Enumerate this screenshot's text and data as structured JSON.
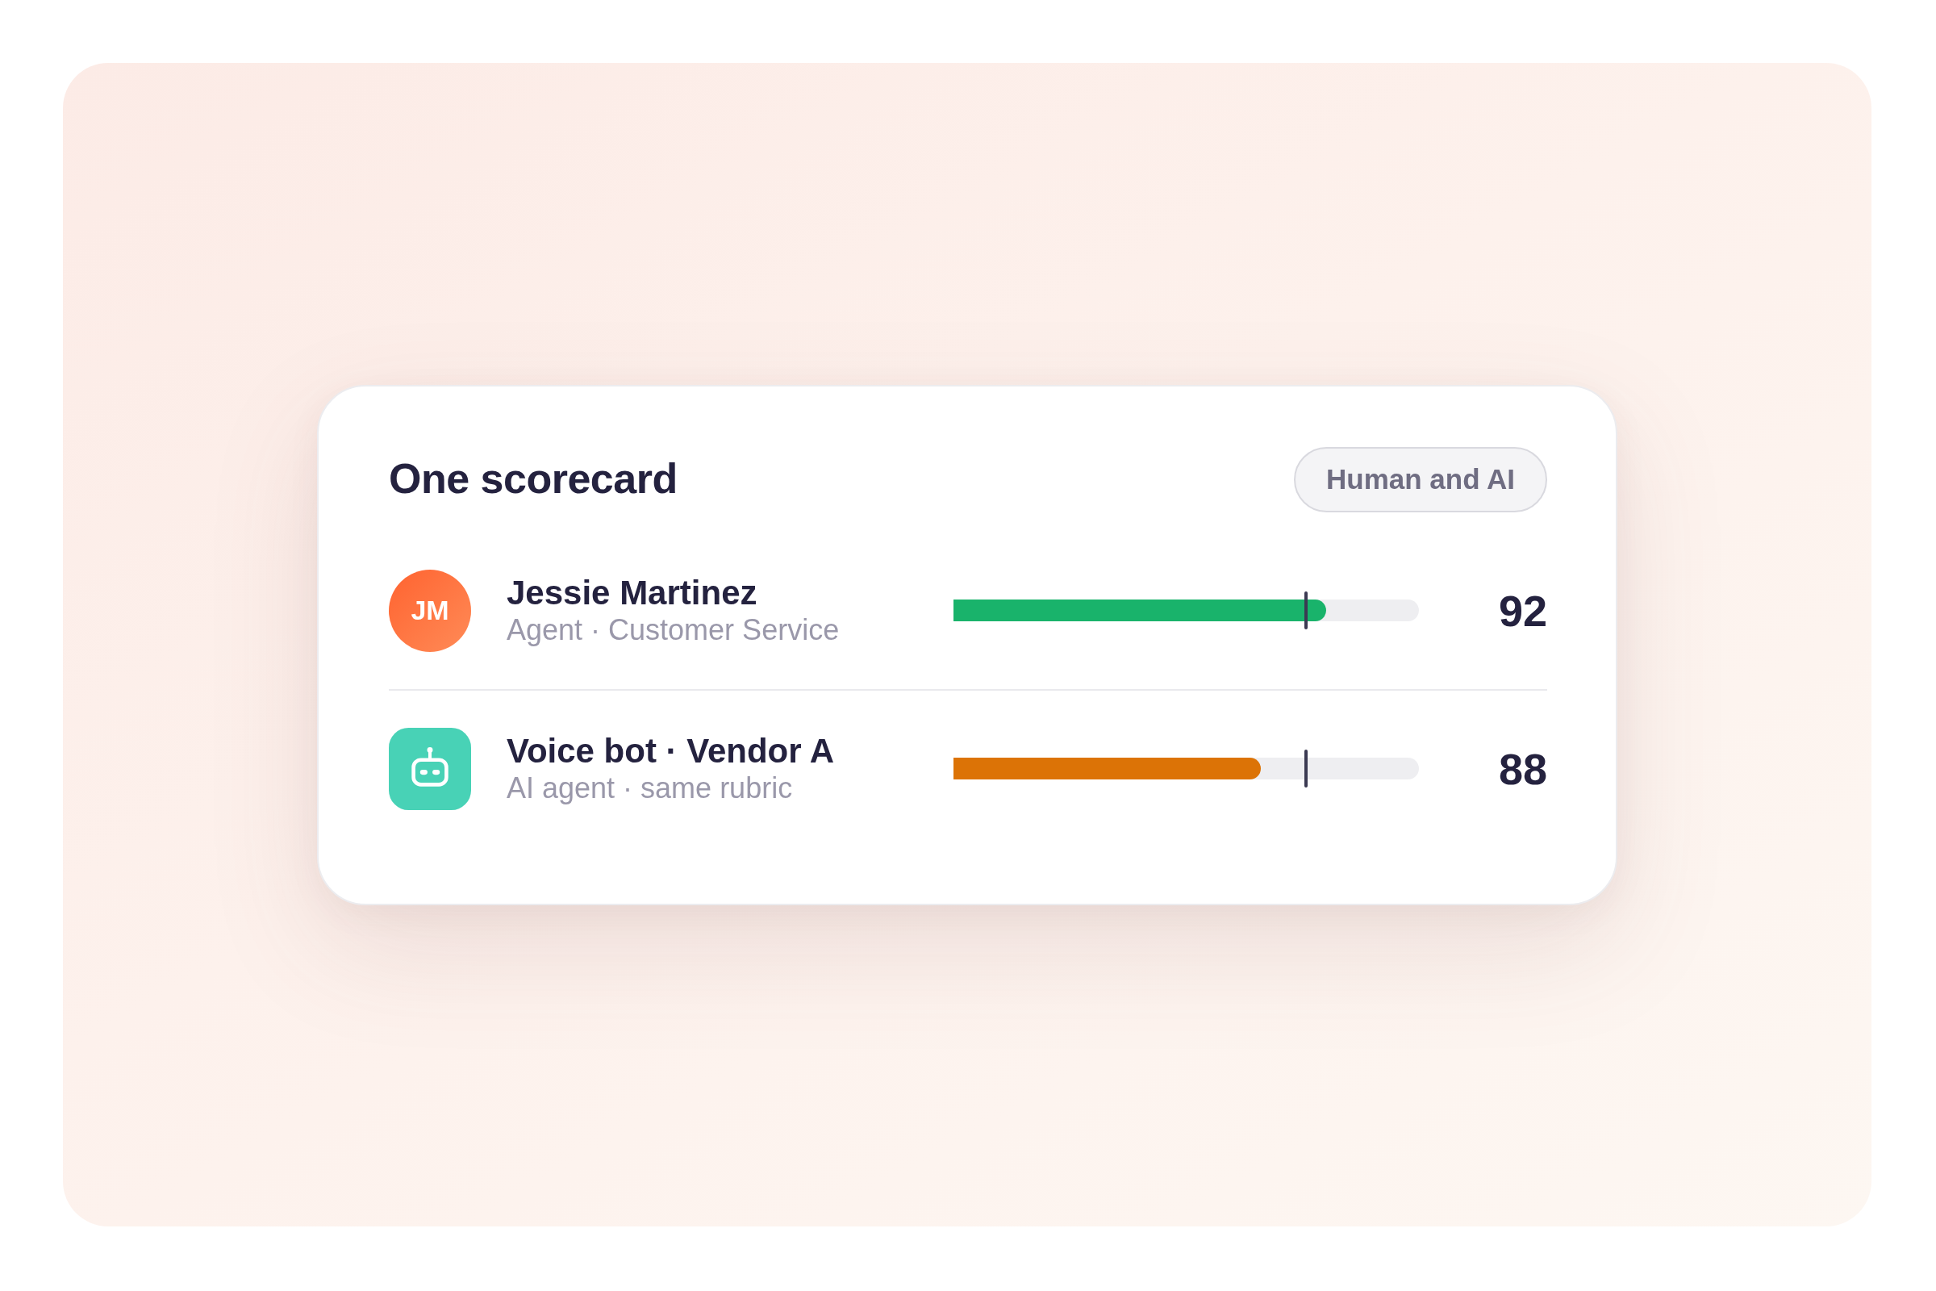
{
  "card": {
    "title": "One scorecard",
    "tag": "Human and AI",
    "rows": [
      {
        "kind": "person",
        "initials": "JM",
        "name": "Jessie Martinez",
        "subtitle": "Agent · Customer Service",
        "level": 0.8,
        "color": "#19b36b",
        "target": {
          "level": 0.757
        },
        "score": "92"
      },
      {
        "kind": "bot",
        "name": "Voice bot · Vendor A",
        "subtitle": "AI agent · same rubric",
        "level": 0.66,
        "color": "#dc7306",
        "target": {
          "level": 0.757
        },
        "score": "88"
      }
    ]
  }
}
